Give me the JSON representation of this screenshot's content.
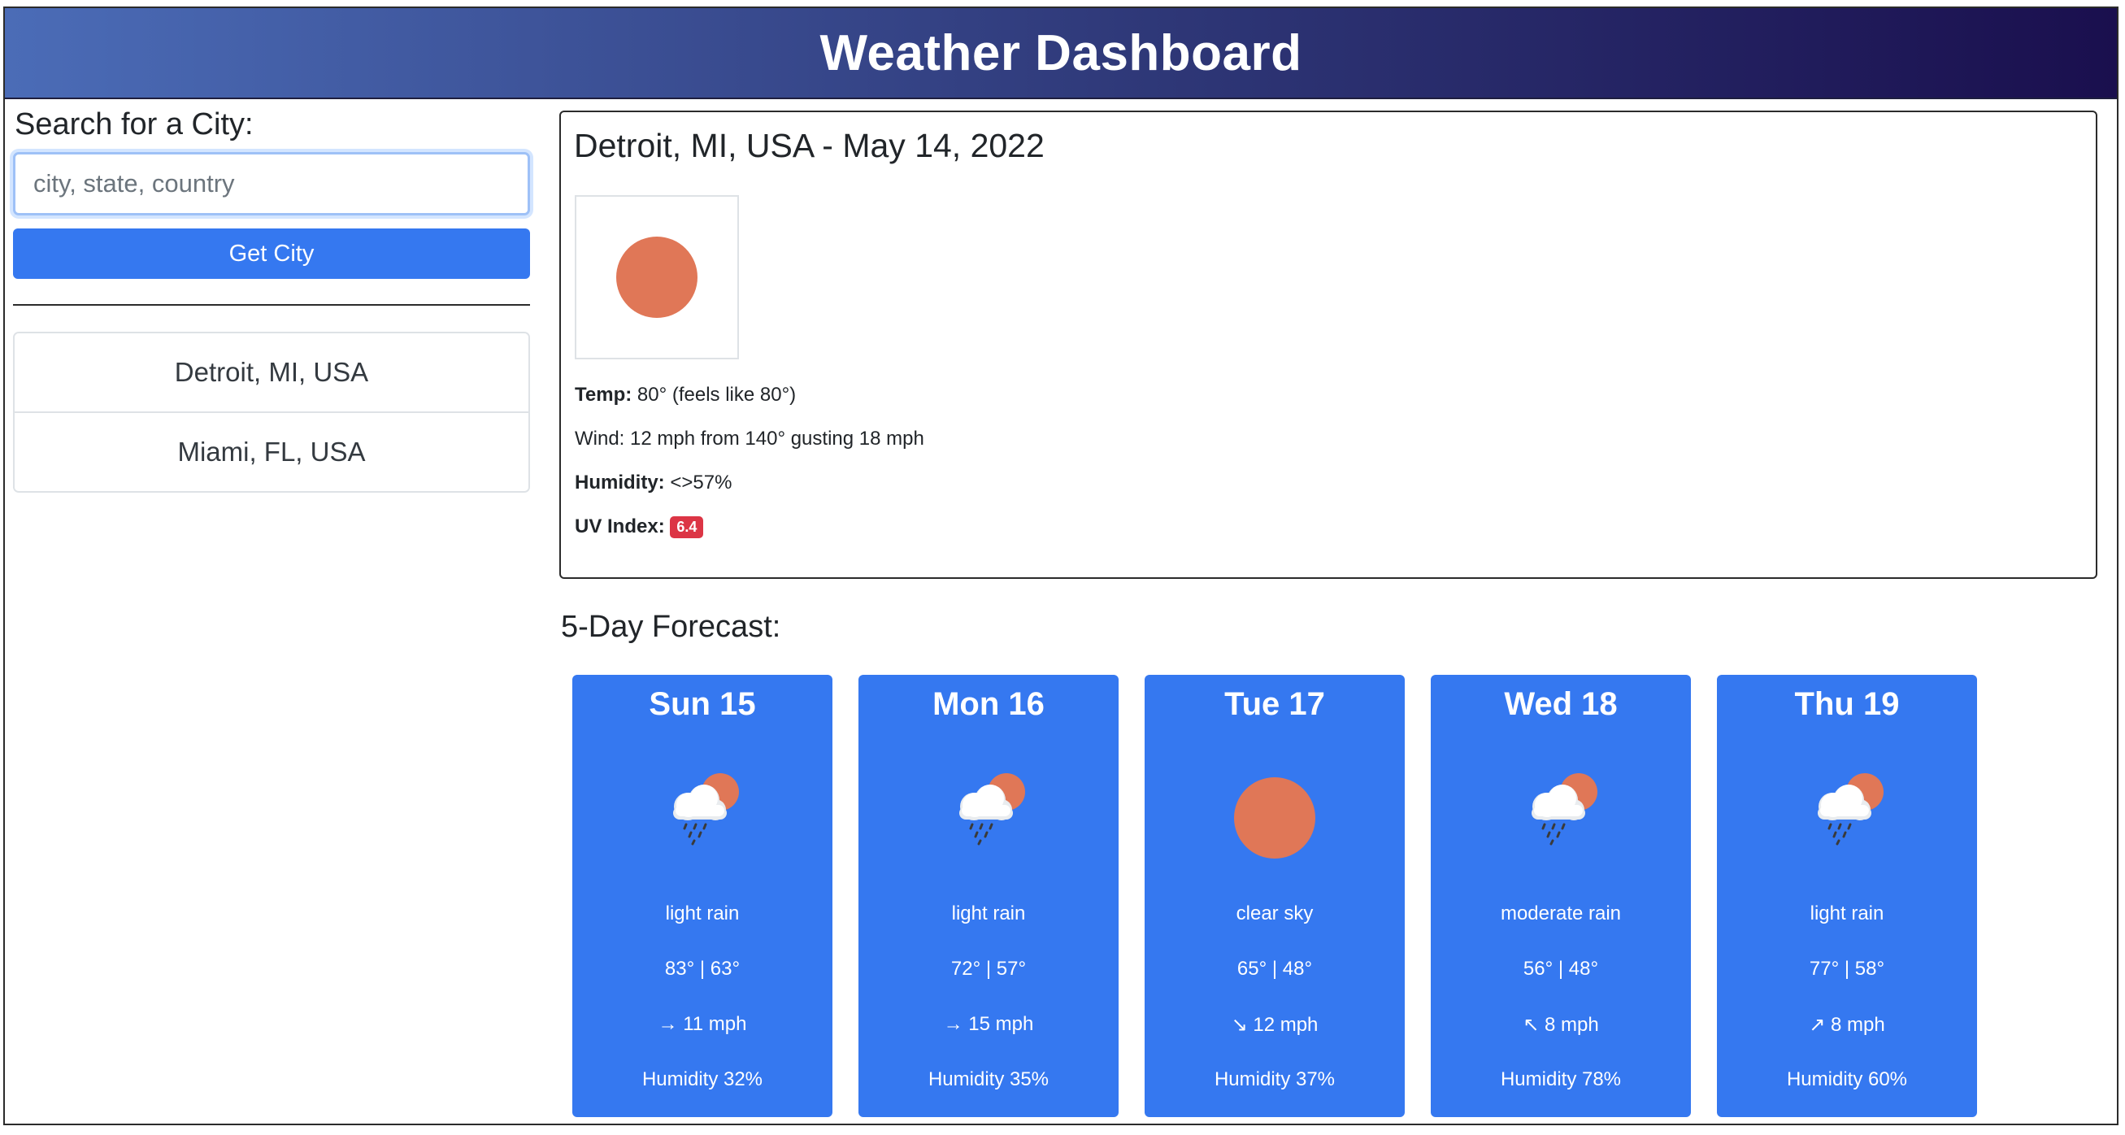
{
  "header": {
    "title": "Weather Dashboard"
  },
  "search": {
    "heading": "Search for a City:",
    "placeholder": "city, state, country",
    "value": "",
    "button_label": "Get City"
  },
  "history": [
    {
      "label": "Detroit, MI, USA"
    },
    {
      "label": "Miami, FL, USA"
    }
  ],
  "current": {
    "title": "Detroit, MI, USA - May 14, 2022",
    "icon": "sun-icon",
    "temp_label": "Temp:",
    "temp_value": "80° (feels like 80°)",
    "wind_text": "Wind: 12 mph from 140° gusting 18 mph",
    "humidity_label": "Humidity:",
    "humidity_value": "<>57%",
    "uv_label": "UV Index:",
    "uv_value": "6.4"
  },
  "forecast": {
    "heading": "5-Day Forecast:",
    "days": [
      {
        "day": "Sun 15",
        "icon": "rain-cloud-sun-icon",
        "desc": "light rain",
        "temps": "83° | 63°",
        "wind": "→ 11 mph",
        "humidity": "Humidity 32%"
      },
      {
        "day": "Mon 16",
        "icon": "rain-cloud-sun-icon",
        "desc": "light rain",
        "temps": "72° | 57°",
        "wind": "→ 15 mph",
        "humidity": "Humidity 35%"
      },
      {
        "day": "Tue 17",
        "icon": "sun-icon",
        "desc": "clear sky",
        "temps": "65° | 48°",
        "wind": "↘ 12 mph",
        "humidity": "Humidity 37%"
      },
      {
        "day": "Wed 18",
        "icon": "rain-cloud-sun-icon",
        "desc": "moderate rain",
        "temps": "56° | 48°",
        "wind": "↖ 8 mph",
        "humidity": "Humidity 78%"
      },
      {
        "day": "Thu 19",
        "icon": "rain-cloud-sun-icon",
        "desc": "light rain",
        "temps": "77° | 58°",
        "wind": "↗ 8 mph",
        "humidity": "Humidity 60%"
      }
    ]
  },
  "colors": {
    "accent": "#3578f0",
    "sun": "#e07757",
    "uv_badge": "#dc3545",
    "header_start": "#4b6cb7",
    "header_end": "#1a0f4e"
  }
}
